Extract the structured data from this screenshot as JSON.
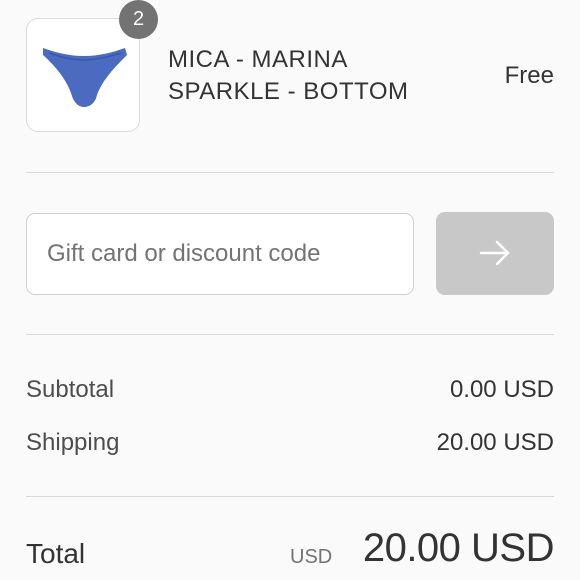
{
  "product": {
    "quantity": "2",
    "name_line1": "MICA - MARINA",
    "name_line2": "SPARKLE - BOTTOM",
    "price": "Free",
    "image_icon": "bikini-bottom-icon",
    "image_color": "#4a6bc0"
  },
  "discount": {
    "placeholder": "Gift card or discount code",
    "value": "",
    "apply_icon": "arrow-right-icon"
  },
  "summary": {
    "subtotal_label": "Subtotal",
    "subtotal_value": "0.00 USD",
    "shipping_label": "Shipping",
    "shipping_value": "20.00 USD",
    "total_label": "Total",
    "total_currency": "USD",
    "total_value": "20.00 USD"
  },
  "colors": {
    "badge": "#737373",
    "button_disabled": "#c8c8c8",
    "divider": "#d9d9d9"
  }
}
